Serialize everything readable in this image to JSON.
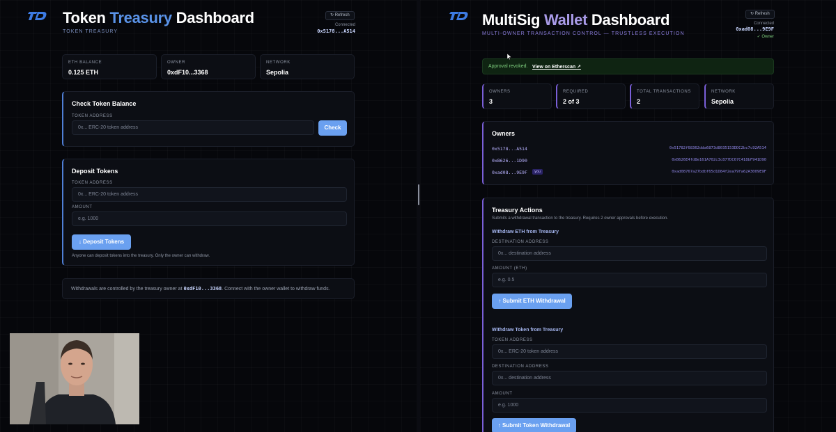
{
  "left": {
    "logo": "TD",
    "title_prefix": "Token ",
    "title_accent": "Treasury",
    "title_suffix": " Dashboard",
    "subtitle": "TOKEN TREASURY",
    "refresh_label": "↻ Refresh",
    "connected_label": "Connected",
    "connected_address": "0x5178...A514",
    "stats": [
      {
        "label": "ETH BALANCE",
        "value": "0.125 ETH"
      },
      {
        "label": "OWNER",
        "value": "0xdF10...3368"
      },
      {
        "label": "NETWORK",
        "value": "Sepolia"
      }
    ],
    "check": {
      "title": "Check Token Balance",
      "token_label": "TOKEN ADDRESS",
      "token_placeholder": "0x... ERC-20 token address",
      "button": "Check"
    },
    "deposit": {
      "title": "Deposit Tokens",
      "token_label": "TOKEN ADDRESS",
      "token_placeholder": "0x... ERC-20 token address",
      "amount_label": "AMOUNT",
      "amount_placeholder": "e.g. 1000",
      "button": "↓ Deposit Tokens",
      "note": "Anyone can deposit tokens into the treasury. Only the owner can withdraw."
    },
    "info": {
      "prefix": "Withdrawals are controlled by the treasury owner at ",
      "address": "0xdF10...3368",
      "suffix": ". Connect with the owner wallet to withdraw funds."
    }
  },
  "right": {
    "logo": "TD",
    "title_prefix": "MultiSig ",
    "title_accent": "Wallet",
    "title_suffix": " Dashboard",
    "subtitle": "MULTI-OWNER TRANSACTION CONTROL — TRUSTLESS EXECUTION",
    "refresh_label": "↻ Refresh",
    "connected_label": "Connected",
    "connected_address": "0xad08...9E9F",
    "owner_badge": "✓ Owner",
    "banner": {
      "text": "Approval revoked.",
      "link": "View on Etherscan ↗"
    },
    "stats": [
      {
        "label": "OWNERS",
        "value": "3"
      },
      {
        "label": "REQUIRED",
        "value": "2 of 3"
      },
      {
        "label": "TOTAL TRANSACTIONS",
        "value": "2"
      },
      {
        "label": "NETWORK",
        "value": "Sepolia"
      }
    ],
    "owners": {
      "title": "Owners",
      "list": [
        {
          "short": "0x5178...A514",
          "full": "0x51782f68362dda6873d8035153DDC2bc7c92A514",
          "you": ""
        },
        {
          "short": "0xB626...1D90",
          "full": "0xB626E4fd8e161A702c3c877DC67C418bF941D90",
          "you": ""
        },
        {
          "short": "0xad08...9E9F",
          "full": "0xad08767a27bdbf65d1D84f2ea79fa62A3009E9F",
          "you": "you"
        }
      ]
    },
    "treasury": {
      "title": "Treasury Actions",
      "description": "Submits a withdrawal transaction to the treasury. Requires 2 owner approvals before execution.",
      "eth": {
        "title": "Withdraw ETH from Treasury",
        "dest_label": "DESTINATION ADDRESS",
        "dest_placeholder": "0x... destination address",
        "amount_label": "AMOUNT (ETH)",
        "amount_placeholder": "e.g. 0.5",
        "button": "↑ Submit ETH Withdrawal"
      },
      "token": {
        "title": "Withdraw Token from Treasury",
        "token_label": "TOKEN ADDRESS",
        "token_placeholder": "0x... ERC-20 token address",
        "dest_label": "DESTINATION ADDRESS",
        "dest_placeholder": "0x... destination address",
        "amount_label": "AMOUNT",
        "amount_placeholder": "e.g. 1000",
        "button": "↑ Submit Token Withdrawal"
      }
    }
  },
  "colors": {
    "accent_blue": "#5a93e8",
    "accent_purple": "#a99be8",
    "button": "#6aa0f0",
    "success": "#7fd07f"
  },
  "icons": [
    "refresh-icon",
    "logo-icon",
    "arrow-down-icon",
    "arrow-up-icon",
    "external-link-icon",
    "check-icon"
  ]
}
